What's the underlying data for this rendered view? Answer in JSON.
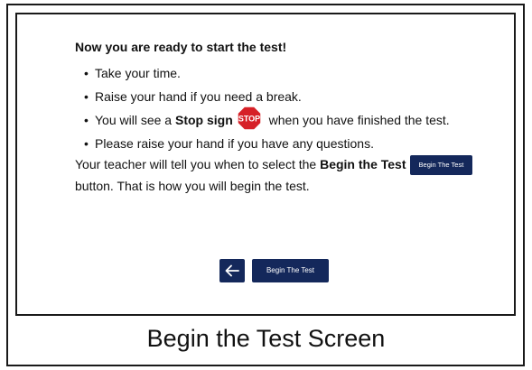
{
  "screen": {
    "heading": "Now you are ready to start the test!",
    "bullets": [
      {
        "text": "Take your time."
      },
      {
        "text": "Raise your hand if you need a break."
      },
      {
        "pre": "You will see a ",
        "bold": "Stop sign",
        "stop_label": "STOP",
        "post": " when you have finished the test."
      },
      {
        "text": "Please raise your hand if you have any questions."
      }
    ],
    "paragraph": {
      "pre": "Your teacher will tell you when to select the ",
      "bold": "Begin the Test",
      "inline_button": "Begin The Test",
      "post": "button. That is how you will begin the test."
    },
    "back_icon": "arrow-left-icon",
    "begin_button": "Begin The Test"
  },
  "caption": "Begin the Test Screen",
  "colors": {
    "button_bg": "#14285b",
    "stop_red": "#d62027"
  }
}
